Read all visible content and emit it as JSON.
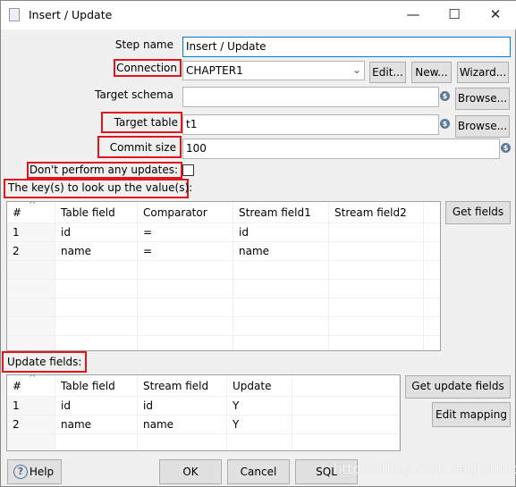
{
  "window": {
    "title": "Insert / Update",
    "controls": {
      "minimize": "—",
      "maximize": "☐",
      "close": "✕"
    }
  },
  "form": {
    "step_name": {
      "label": "Step name",
      "value": "Insert / Update"
    },
    "connection": {
      "label": "Connection",
      "value": "CHAPTER1",
      "edit": "Edit...",
      "new": "New...",
      "wizard": "Wizard..."
    },
    "target_schema": {
      "label": "Target schema",
      "value": "",
      "browse": "Browse..."
    },
    "target_table": {
      "label": "Target table",
      "value": "t1",
      "browse": "Browse..."
    },
    "commit_size": {
      "label": "Commit size",
      "value": "100"
    },
    "dont_update": {
      "label": "Don't perform any updates:",
      "checked": false
    }
  },
  "keys": {
    "label": "The key(s) to look up the value(s):",
    "get_fields": "Get fields",
    "columns": [
      "#",
      "Table field",
      "Comparator",
      "Stream field1",
      "Stream field2"
    ],
    "rows": [
      [
        "1",
        "id",
        "=",
        "id",
        ""
      ],
      [
        "2",
        "name",
        "=",
        "name",
        ""
      ]
    ]
  },
  "update": {
    "label": "Update fields:",
    "get_update_fields": "Get update fields",
    "edit_mapping": "Edit mapping",
    "columns": [
      "#",
      "Table field",
      "Stream field",
      "Update"
    ],
    "rows": [
      [
        "1",
        "id",
        "id",
        "Y"
      ],
      [
        "2",
        "name",
        "name",
        "Y"
      ]
    ]
  },
  "footer": {
    "help": "Help",
    "ok": "OK",
    "cancel": "Cancel",
    "sql": "SQL"
  },
  "watermark": "https://blog.csdn.net/JpHold",
  "colors": {
    "highlight": "#e0161f",
    "focus": "#0078d7"
  }
}
